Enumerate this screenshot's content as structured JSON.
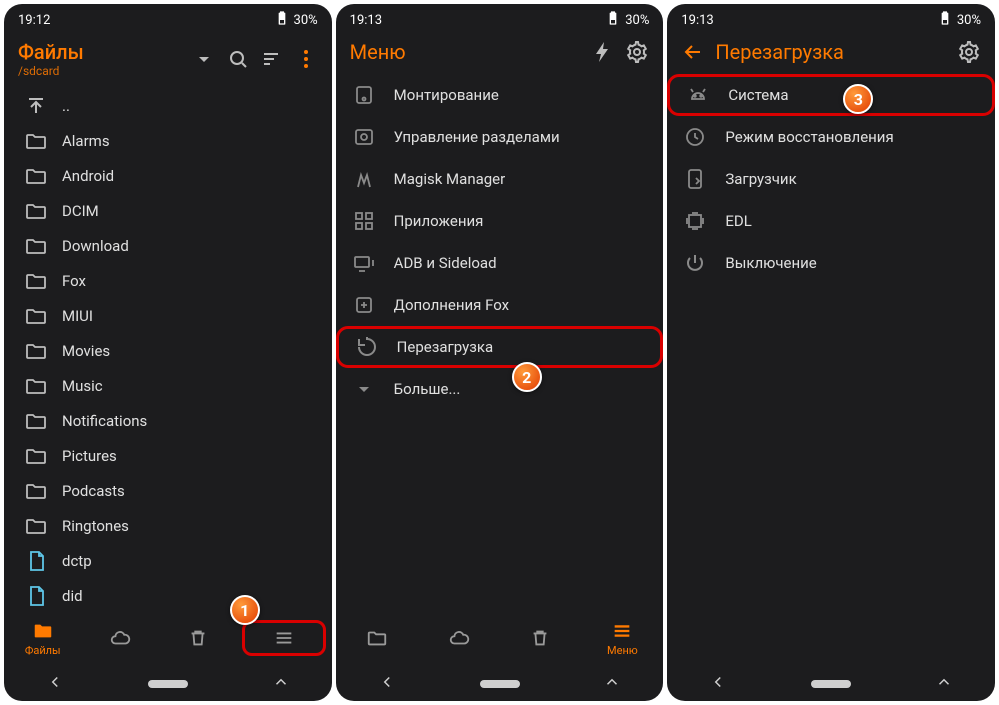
{
  "panel1": {
    "status": {
      "time": "19:12",
      "battery": "30%"
    },
    "title": "Файлы",
    "subtitle": "/sdcard",
    "items": [
      {
        "icon": "up",
        "label": ".."
      },
      {
        "icon": "folder",
        "label": "Alarms"
      },
      {
        "icon": "folder",
        "label": "Android"
      },
      {
        "icon": "folder",
        "label": "DCIM"
      },
      {
        "icon": "folder",
        "label": "Download"
      },
      {
        "icon": "folder",
        "label": "Fox"
      },
      {
        "icon": "folder",
        "label": "MIUI"
      },
      {
        "icon": "folder",
        "label": "Movies"
      },
      {
        "icon": "folder",
        "label": "Music"
      },
      {
        "icon": "folder",
        "label": "Notifications"
      },
      {
        "icon": "folder",
        "label": "Pictures"
      },
      {
        "icon": "folder",
        "label": "Podcasts"
      },
      {
        "icon": "folder",
        "label": "Ringtones"
      },
      {
        "icon": "file",
        "label": "dctp"
      },
      {
        "icon": "file",
        "label": "did"
      }
    ],
    "nav": {
      "files": "Файлы",
      "menu": "Меню"
    },
    "badge": "1"
  },
  "panel2": {
    "status": {
      "time": "19:13",
      "battery": "30%"
    },
    "title": "Меню",
    "items": [
      {
        "label": "Монтирование"
      },
      {
        "label": "Управление разделами"
      },
      {
        "label": "Magisk Manager"
      },
      {
        "label": "Приложения"
      },
      {
        "label": "ADB и Sideload"
      },
      {
        "label": "Дополнения Fox"
      },
      {
        "label": "Перезагрузка"
      },
      {
        "label": "Больше..."
      }
    ],
    "nav": {
      "files": "Файлы",
      "menu": "Меню"
    },
    "badge": "2"
  },
  "panel3": {
    "status": {
      "time": "19:13",
      "battery": "30%"
    },
    "title": "Перезагрузка",
    "items": [
      {
        "label": "Система"
      },
      {
        "label": "Режим восстановления"
      },
      {
        "label": "Загрузчик"
      },
      {
        "label": "EDL"
      },
      {
        "label": "Выключение"
      }
    ],
    "badge": "3"
  }
}
